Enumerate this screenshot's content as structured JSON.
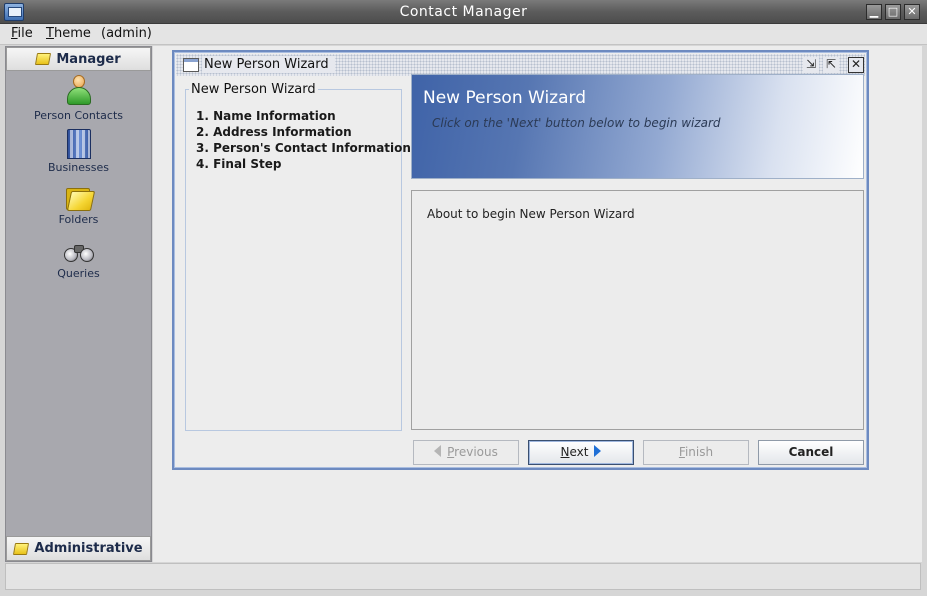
{
  "window": {
    "title": "Contact Manager",
    "controls": {
      "minimize": "▁",
      "maximize": "□",
      "close": "✕"
    }
  },
  "menu": {
    "file": {
      "mnemonic": "F",
      "rest": "ile"
    },
    "theme": {
      "mnemonic": "T",
      "rest": "heme"
    },
    "user": "(admin)"
  },
  "sidebar": {
    "header": "Manager",
    "items": [
      {
        "label": "Person Contacts",
        "icon": "person-icon"
      },
      {
        "label": "Businesses",
        "icon": "building-icon"
      },
      {
        "label": "Folders",
        "icon": "folder-icon"
      },
      {
        "label": "Queries",
        "icon": "binoculars-icon"
      }
    ],
    "footer": "Administrative"
  },
  "internal_frame": {
    "title": "New Person Wizard",
    "controls": {
      "minimize": "⇲",
      "maximize": "⇱",
      "close": "✕"
    }
  },
  "wizard": {
    "steps_title": "New Person Wizard",
    "steps": [
      "1. Name Information",
      "2. Address Information",
      "3. Person's Contact Information",
      "4. Final Step"
    ],
    "banner_title": "New Person Wizard",
    "banner_subtitle": "Click on the 'Next' button below to begin wizard",
    "body_text": "About to begin New Person Wizard",
    "buttons": {
      "previous": {
        "mnemonic": "P",
        "rest": "revious",
        "enabled": false
      },
      "next": {
        "mnemonic": "N",
        "rest": "ext",
        "enabled": true
      },
      "finish": {
        "mnemonic": "F",
        "rest": "inish",
        "enabled": false
      },
      "cancel": {
        "label": "Cancel",
        "enabled": true
      }
    }
  },
  "colors": {
    "banner_start": "#3f63a8",
    "banner_end": "#ffffff",
    "sidebar_bg": "#a8a8ae",
    "frame_border": "#6d8ac0",
    "next_arrow": "#1f6fd6"
  }
}
